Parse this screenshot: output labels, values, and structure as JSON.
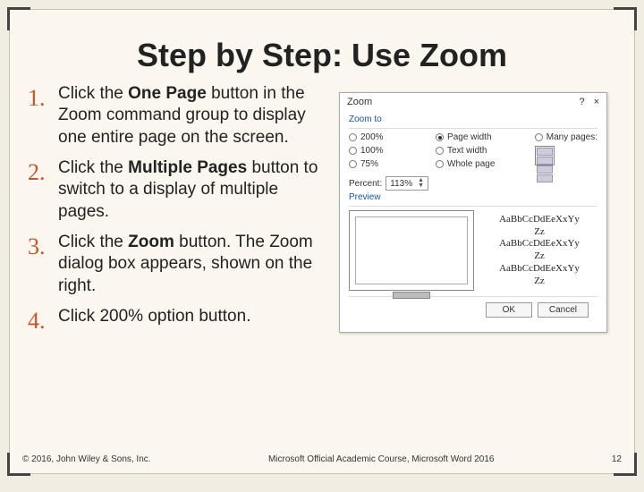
{
  "title": "Step by Step: Use Zoom",
  "steps": {
    "s1a": "Click the ",
    "s1b": "One Page",
    "s1c": " button in the Zoom command group to display one entire page on the screen.",
    "s2a": "Click the ",
    "s2b": "Multiple Pages",
    "s2c": " button to switch to a display of multiple pages.",
    "s3a": "Click the ",
    "s3b": "Zoom",
    "s3c": " button. The Zoom dialog box appears, shown on the right.",
    "s4": "Click 200% option button."
  },
  "dialog": {
    "title": "Zoom",
    "help": "?",
    "close": "×",
    "zoomto": "Zoom to",
    "r200": "200%",
    "r100": "100%",
    "r75": "75%",
    "pw": "Page width",
    "tw": "Text width",
    "wp": "Whole page",
    "mp": "Many pages:",
    "percent_lbl": "Percent:",
    "percent_val": "113%",
    "preview": "Preview",
    "sample1": "AaBbCcDdEeXxYy",
    "sample2": "Zz",
    "ok": "OK",
    "cancel": "Cancel"
  },
  "footer": {
    "left": "© 2016, John Wiley & Sons, Inc.",
    "center": "Microsoft Official Academic Course, Microsoft Word 2016",
    "page": "12"
  }
}
